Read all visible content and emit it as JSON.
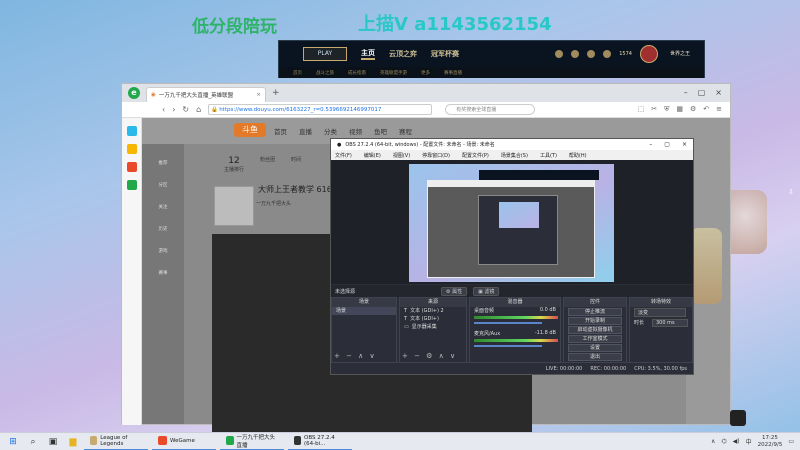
{
  "watermarks": {
    "left": "低分段陪玩",
    "right": "上描Ⅴ a1143562154"
  },
  "lol_client": {
    "play": "PLAY",
    "tabs": [
      "主页",
      "云顶之弈",
      "冠军杯赛"
    ],
    "sub_tabs": [
      "首页",
      "战斗之旅",
      "成长指南",
      "英雄联盟手游",
      "更多",
      "赛事直播"
    ],
    "coins": "1574",
    "user": "世界之王"
  },
  "browser": {
    "logo": "e",
    "tab_title": "一万九千把大头直播_英雄联盟",
    "url": "https://www.douyu.com/6163227_r=0.5396692146997017",
    "search_placeholder": "有奖搜索全球直播",
    "nav_back": "‹",
    "nav_fwd": "›",
    "nav_reload": "↻",
    "nav_home": "⌂"
  },
  "douyu": {
    "logo": "斗鱼",
    "nav": [
      "首页",
      "直播",
      "分类",
      "视频",
      "鱼吧",
      "赛程"
    ],
    "counts": [
      {
        "num": "12",
        "label": "主播排行"
      },
      {
        "num": "",
        "label": "粉丝团"
      },
      {
        "num": "",
        "label": "时间"
      }
    ],
    "streamer": "大师上王者教学",
    "room_id": "616322",
    "sub": "一万九千把大头",
    "left_nav": [
      "推荐",
      "分区",
      "关注",
      "历史",
      "游戏",
      "赛事"
    ]
  },
  "obs": {
    "title": "OBS 27.2.4 (64-bit, windows) - 配置文件: 未命名 - 场景: 未命名",
    "menu": [
      "文件(F)",
      "编辑(E)",
      "视图(V)",
      "停靠窗口(D)",
      "配置文件(P)",
      "场景集合(S)",
      "工具(T)",
      "帮助(H)"
    ],
    "no_source": "未选择源",
    "props_btn": "⚙ 属性",
    "filter_btn": "▣ 滤镜",
    "panel_titles": [
      "场景",
      "来源",
      "混音器",
      "控件",
      "转场特效"
    ],
    "scenes": [
      "场景"
    ],
    "sources": [
      "文本 (GDI+) 2",
      "文本 (GDI+)",
      "显示器采集"
    ],
    "mixer": [
      {
        "name": "桌面音频",
        "db": "0.0 dB"
      },
      {
        "name": "麦克风/Aux",
        "db": "-11.8 dB"
      }
    ],
    "controls": [
      "停止推流",
      "开始录制",
      "启动虚拟摄像机",
      "工作室模式",
      "设置",
      "退出"
    ],
    "transition": {
      "type": "淡变",
      "duration_label": "时长",
      "duration": "300 ms"
    },
    "status": [
      "LIVE: 00:00:00",
      "REC: 00:00:00",
      "CPU: 3.5%, 30.00 fps"
    ]
  },
  "taskbar": {
    "apps": [
      {
        "name": "League of Legends",
        "color": "#c8aa6e"
      },
      {
        "name": "WeGame",
        "color": "#e94a2a"
      },
      {
        "name": "一万九千把大头直播",
        "color": "#21a84a"
      },
      {
        "name": "OBS 27.2.4 (64-bi...",
        "color": "#333333"
      }
    ],
    "time": "17:25",
    "date": "2022/9/5",
    "lang": "中"
  }
}
